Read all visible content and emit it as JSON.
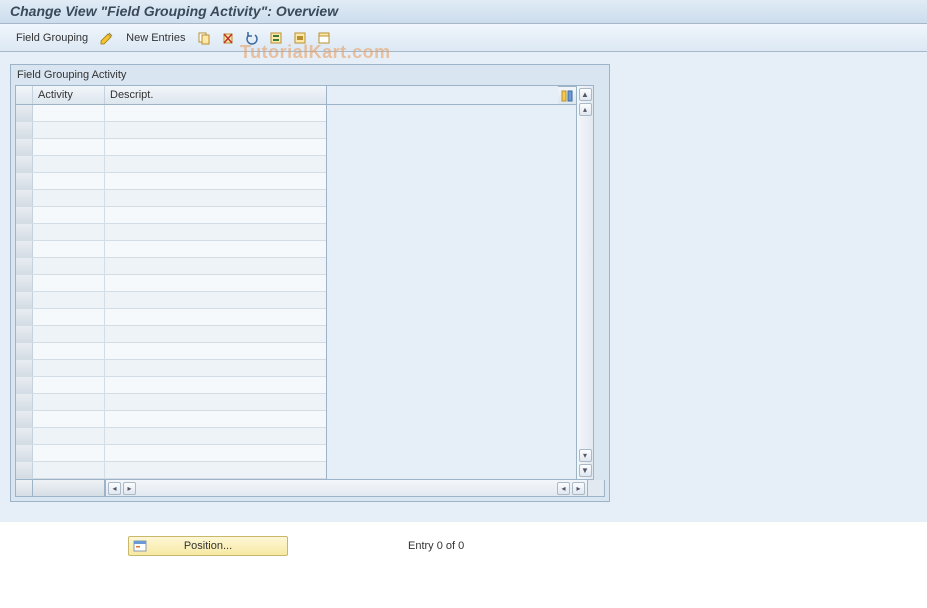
{
  "title": "Change View \"Field Grouping Activity\": Overview",
  "toolbar": {
    "field_grouping": "Field Grouping",
    "new_entries": "New Entries"
  },
  "watermark": "TutorialKart.com",
  "panel": {
    "title": "Field Grouping Activity",
    "columns": {
      "activity": "Activity",
      "descript": "Descript."
    },
    "rows": [
      {
        "activity": "",
        "descript": ""
      },
      {
        "activity": "",
        "descript": ""
      },
      {
        "activity": "",
        "descript": ""
      },
      {
        "activity": "",
        "descript": ""
      },
      {
        "activity": "",
        "descript": ""
      },
      {
        "activity": "",
        "descript": ""
      },
      {
        "activity": "",
        "descript": ""
      },
      {
        "activity": "",
        "descript": ""
      },
      {
        "activity": "",
        "descript": ""
      },
      {
        "activity": "",
        "descript": ""
      },
      {
        "activity": "",
        "descript": ""
      },
      {
        "activity": "",
        "descript": ""
      },
      {
        "activity": "",
        "descript": ""
      },
      {
        "activity": "",
        "descript": ""
      },
      {
        "activity": "",
        "descript": ""
      },
      {
        "activity": "",
        "descript": ""
      },
      {
        "activity": "",
        "descript": ""
      },
      {
        "activity": "",
        "descript": ""
      },
      {
        "activity": "",
        "descript": ""
      },
      {
        "activity": "",
        "descript": ""
      },
      {
        "activity": "",
        "descript": ""
      },
      {
        "activity": "",
        "descript": ""
      }
    ]
  },
  "footer": {
    "position_label": "Position...",
    "entry_text": "Entry 0 of 0"
  }
}
